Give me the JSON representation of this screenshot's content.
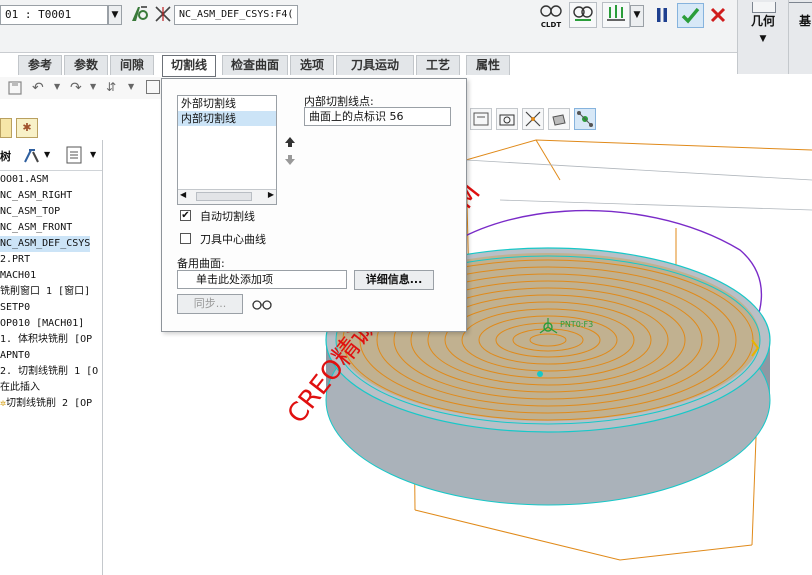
{
  "dashboard": {
    "tool_field": "01 : T0001",
    "csys_field": "NC_ASM_DEF_CSYS:F4(",
    "cldt_label": "CLDT",
    "pause_icon": "pause-icon",
    "confirm_icon": "check-icon",
    "cancel_icon": "x-icon",
    "geometry_label": "几何",
    "base_label": "基"
  },
  "tabs": [
    "参考",
    "参数",
    "间隙",
    "切割线",
    "检查曲面",
    "选项",
    "刀具运动",
    "工艺",
    "属性"
  ],
  "active_tab": "切割线",
  "model_tree": {
    "header_label": "树",
    "items": [
      "OO01.ASM",
      "NC_ASM_RIGHT",
      "NC_ASM_TOP",
      "NC_ASM_FRONT",
      "NC_ASM_DEF_CSYS",
      "2.PRT",
      "MACH01",
      "铣削窗口 1 [窗口]",
      "SETP0",
      "OP010 [MACH01]",
      "1. 体积块铣削 [OP",
      "APNT0",
      "2. 切割线铣削 1 [O",
      "在此插入",
      "切割线铣削 2 [OP"
    ]
  },
  "cutline_panel": {
    "list": [
      "外部切割线",
      "内部切割线"
    ],
    "selected_index": 1,
    "inner_point_label": "内部切割线点:",
    "inner_point_value": "曲面上的点标识 56",
    "auto_cutline_label": "自动切割线",
    "auto_cutline_checked": true,
    "tool_center_label": "刀具中心曲线",
    "tool_center_checked": false,
    "backup_surface_label": "备用曲面:",
    "backup_surface_placeholder": "单击此处添加项",
    "details_label": "详细信息...",
    "sync_label": "同步..."
  },
  "graphics": {
    "watermark": "CREO精诚网CAXIT.COM",
    "point_label": "PNT0:F3"
  },
  "colors": {
    "accent_blue": "#1e66c8",
    "selection": "#cce4f7",
    "confirm_green": "#2a9d3a",
    "cancel_red": "#d01c1c",
    "watermark_red": "#e01010",
    "toolpath_orange": "#e08a1a",
    "curve_purple": "#7a2bc8",
    "edge_cyan": "#17c8c8",
    "surface_gray": "#9aa3ad"
  }
}
